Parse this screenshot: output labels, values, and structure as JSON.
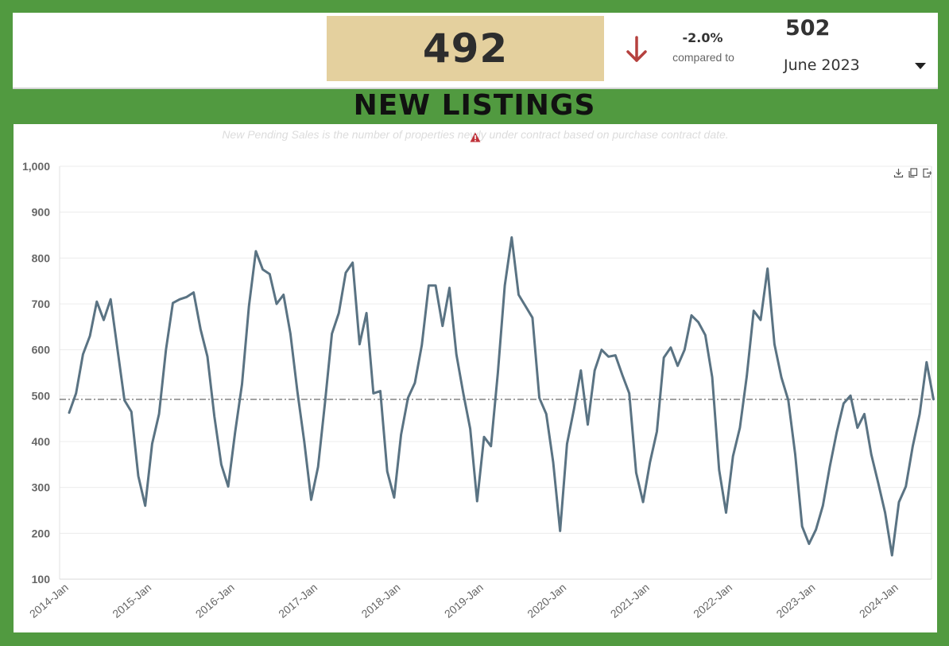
{
  "kpi": {
    "value": "492",
    "change_pct": "-2.0%",
    "compared_label": "compared to",
    "compare_value": "502",
    "compare_period": "June 2023",
    "trend_icon": "arrow-down-icon",
    "trend_color": "#b5413e",
    "box_color": "#e4d09e"
  },
  "section_title": "NEW LISTINGS",
  "chart_subtitle": "New Pending Sales is the number of properties newly under contract based on purchase contract date.",
  "toolbar_icons": [
    "download-icon",
    "copy-icon",
    "export-icon"
  ],
  "colors": {
    "background": "#519a40",
    "line": "#5a7383",
    "reference_line": "#444444"
  },
  "chart_data": {
    "type": "line",
    "title": "",
    "xlabel": "",
    "ylabel": "",
    "ylim": [
      100,
      1000
    ],
    "yticks": [
      100,
      200,
      300,
      400,
      500,
      600,
      700,
      800,
      900,
      1000
    ],
    "ytick_labels": [
      "100",
      "200",
      "300",
      "400",
      "500",
      "600",
      "700",
      "800",
      "900",
      "1,000"
    ],
    "xtick_labels": [
      "2014-Jan",
      "2015-Jan",
      "2016-Jan",
      "2017-Jan",
      "2018-Jan",
      "2019-Jan",
      "2020-Jan",
      "2021-Jan",
      "2022-Jan",
      "2023-Jan",
      "2024-Jan"
    ],
    "x_start": "2014-Jan",
    "x_end": "2024-Jun",
    "grid": true,
    "reference_line": {
      "value": 492,
      "style": "dash-dot"
    },
    "series": [
      {
        "values": [
          463,
          505,
          590,
          630,
          705,
          665,
          710,
          600,
          490,
          465,
          325,
          260,
          395,
          460,
          600,
          702,
          710,
          715,
          725,
          645,
          585,
          455,
          350,
          302,
          420,
          525,
          695,
          815,
          775,
          765,
          700,
          720,
          635,
          510,
          400,
          273,
          345,
          485,
          635,
          680,
          768,
          790,
          612,
          680,
          505,
          510,
          335,
          278,
          415,
          495,
          528,
          610,
          740,
          740,
          652,
          735,
          590,
          505,
          428,
          270,
          410,
          390,
          550,
          740,
          845,
          720,
          695,
          670,
          495,
          460,
          355,
          205,
          395,
          470,
          555,
          437,
          555,
          600,
          585,
          588,
          545,
          505,
          332,
          268,
          355,
          422,
          583,
          605,
          565,
          600,
          675,
          660,
          632,
          540,
          338,
          245,
          368,
          430,
          543,
          685,
          665,
          777,
          612,
          540,
          490,
          372,
          215,
          177,
          208,
          260,
          345,
          420,
          483,
          500,
          430,
          460,
          372,
          310,
          245,
          152,
          268,
          302,
          390,
          460,
          573,
          492
        ]
      }
    ]
  }
}
